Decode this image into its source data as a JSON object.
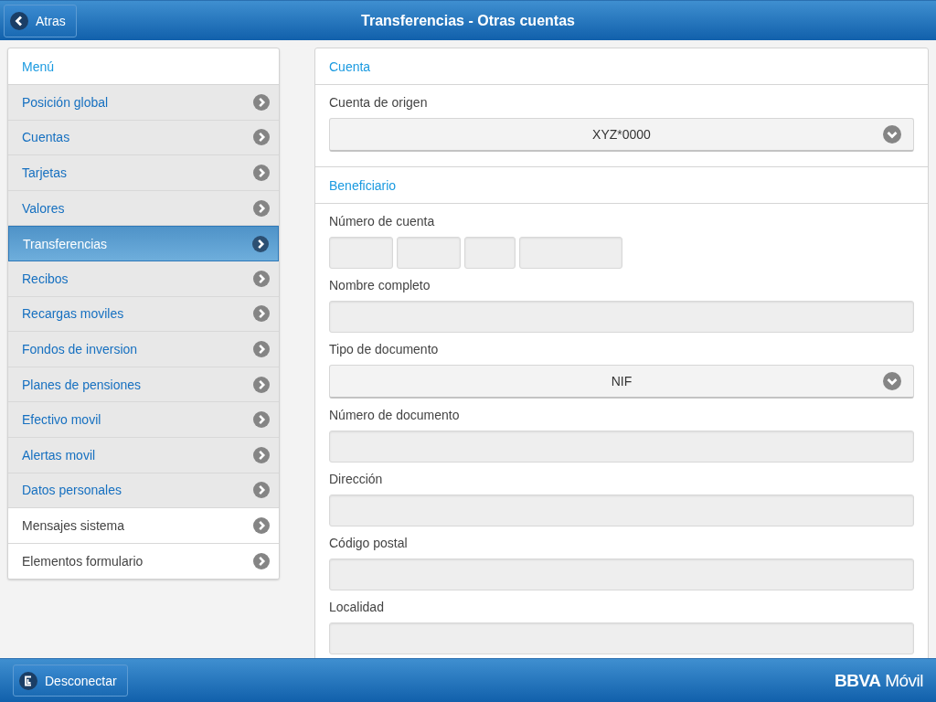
{
  "header": {
    "back_button": "Atras",
    "title": "Transferencias - Otras cuentas"
  },
  "menu": {
    "title": "Menú",
    "items": [
      {
        "label": "Posición global",
        "kind": "nav",
        "selected": false
      },
      {
        "label": "Cuentas",
        "kind": "nav",
        "selected": false
      },
      {
        "label": "Tarjetas",
        "kind": "nav",
        "selected": false
      },
      {
        "label": "Valores",
        "kind": "nav",
        "selected": false
      },
      {
        "label": "Transferencias",
        "kind": "nav",
        "selected": true
      },
      {
        "label": "Recibos",
        "kind": "nav",
        "selected": false
      },
      {
        "label": "Recargas moviles",
        "kind": "nav",
        "selected": false
      },
      {
        "label": "Fondos de inversion",
        "kind": "nav",
        "selected": false
      },
      {
        "label": "Planes de pensiones",
        "kind": "nav",
        "selected": false
      },
      {
        "label": "Efectivo movil",
        "kind": "nav",
        "selected": false
      },
      {
        "label": "Alertas movil",
        "kind": "nav",
        "selected": false
      },
      {
        "label": "Datos personales",
        "kind": "nav",
        "selected": false
      },
      {
        "label": "Mensajes sistema",
        "kind": "plain",
        "selected": false
      },
      {
        "label": "Elementos formulario",
        "kind": "plain",
        "selected": false
      }
    ]
  },
  "form": {
    "sections": [
      {
        "title": "Cuenta",
        "fields": [
          {
            "label": "Cuenta de origen",
            "kind": "select",
            "value": "XYZ*0000"
          }
        ]
      },
      {
        "title": "Beneficiario",
        "fields": [
          {
            "label": "Número de cuenta",
            "kind": "split"
          },
          {
            "label": "Nombre completo",
            "kind": "text"
          },
          {
            "label": "Tipo de documento",
            "kind": "select",
            "value": "NIF"
          },
          {
            "label": "Número de documento",
            "kind": "text"
          },
          {
            "label": "Dirección",
            "kind": "text"
          },
          {
            "label": "Código postal",
            "kind": "text"
          },
          {
            "label": "Localidad",
            "kind": "text"
          }
        ]
      }
    ]
  },
  "footer": {
    "logout_button": "Desconectar",
    "logo": "**BBVA** Móvil"
  }
}
